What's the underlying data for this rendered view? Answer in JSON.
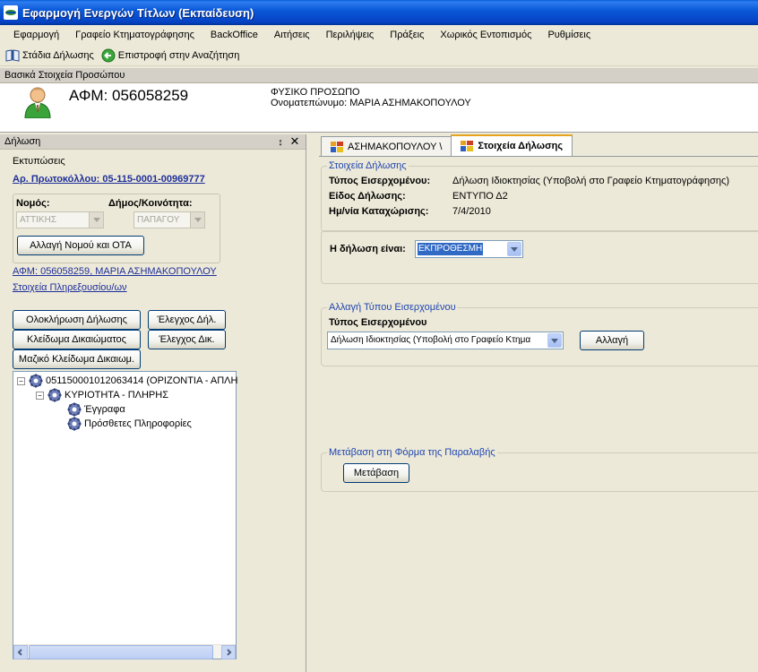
{
  "window": {
    "title": "Εφαρμογή Ενεργών Τίτλων (Εκπαίδευση)"
  },
  "menu": [
    "Εφαρμογή",
    "Γραφείο Κτηματογράφησης",
    "BackOffice",
    "Αιτήσεις",
    "Περιλήψεις",
    "Πράξεις",
    "Χωρικός Εντοπισμός",
    "Ρυθμίσεις"
  ],
  "toolbar": {
    "stages": "Στάδια Δήλωσης",
    "back": "Επιστροφή στην Αναζήτηση"
  },
  "person": {
    "section_label": "Βασικά Στοιχεία Προσώπου",
    "afm": "ΑΦΜ: 056058259",
    "type": "ΦΥΣΙΚΟ ΠΡΟΣΩΠΟ",
    "fullname": "Ονοματεπώνυμο: ΜΑΡΙΑ ΑΣΗΜΑΚΟΠΟΥΛΟΥ"
  },
  "left_panel": {
    "title": "Δήλωση",
    "pin": "↕",
    "close": "✕",
    "prints": "Εκτυπώσεις",
    "protocol": "Αρ. Πρωτοκόλλου: 05-115-0001-00969777",
    "nomos_label": "Νομός:",
    "nomos_value": "ΑΤΤΙΚΗΣ",
    "dimos_label": "Δήμος/Κοινότητα:",
    "dimos_value": "ΠΑΠΑΓΟΥ",
    "change_region_btn": "Αλλαγή Νομού και ΟΤΑ",
    "owner_link": "ΑΦΜ: 056058259, ΜΑΡΙΑ ΑΣΗΜΑΚΟΠΟΥΛΟΥ",
    "agents_link": "Στοιχεία Πληρεξουσίου/ων",
    "btn_complete": "Ολοκλήρωση Δήλωσης",
    "btn_check_decl": "Έλεγχος Δήλ.",
    "btn_lock": "Κλείδωμα Δικαιώματος",
    "btn_check_right": "Έλεγχος Δικ.",
    "btn_mass_lock": "Μαζικό Κλείδωμα Δικαιωμ.",
    "tree": [
      {
        "label": "051150001012063414 (ΟΡΙΖΟΝΤΙΑ - ΑΠΛΗ",
        "expander": "−"
      },
      {
        "label": "ΚΥΡΙΟΤΗΤΑ - ΠΛΗΡΗΣ",
        "expander": "−"
      },
      {
        "label": "Έγγραφα"
      },
      {
        "label": "Πρόσθετες Πληροφορίες"
      }
    ]
  },
  "tabs": [
    {
      "label": "ΑΣΗΜΑΚΟΠΟΥΛΟΥ \\"
    },
    {
      "label": "Στοιχεία Δήλωσης"
    }
  ],
  "details": {
    "group_title": "Στοιχεία Δήλωσης",
    "type_label": "Τύπος Εισερχομένου:",
    "type_value": "Δήλωση Ιδιοκτησίας  (Υποβολή στο Γραφείο Κτηματογράφησης)",
    "kind_label": "Είδος Δήλωσης:",
    "kind_value": "ΕΝΤΥΠΟ Δ2",
    "date_label": "Ημ/νία Καταχώρισης:",
    "date_value": "7/4/2010"
  },
  "timeliness": {
    "label": "Η δήλωση είναι:",
    "value": "ΕΚΠΡΟΘΕΣΜΗ"
  },
  "change_type": {
    "group_title": "Αλλαγή Τύπου Εισερχομένου",
    "label": "Τύπος Εισερχομένου",
    "value": "Δήλωση Ιδιοκτησίας  (Υποβολή στο Γραφείο Κτημα",
    "button": "Αλλαγή"
  },
  "transfer": {
    "group_title": "Μετάβαση στη Φόρμα της Παραλαβής",
    "button": "Μετάβαση"
  }
}
